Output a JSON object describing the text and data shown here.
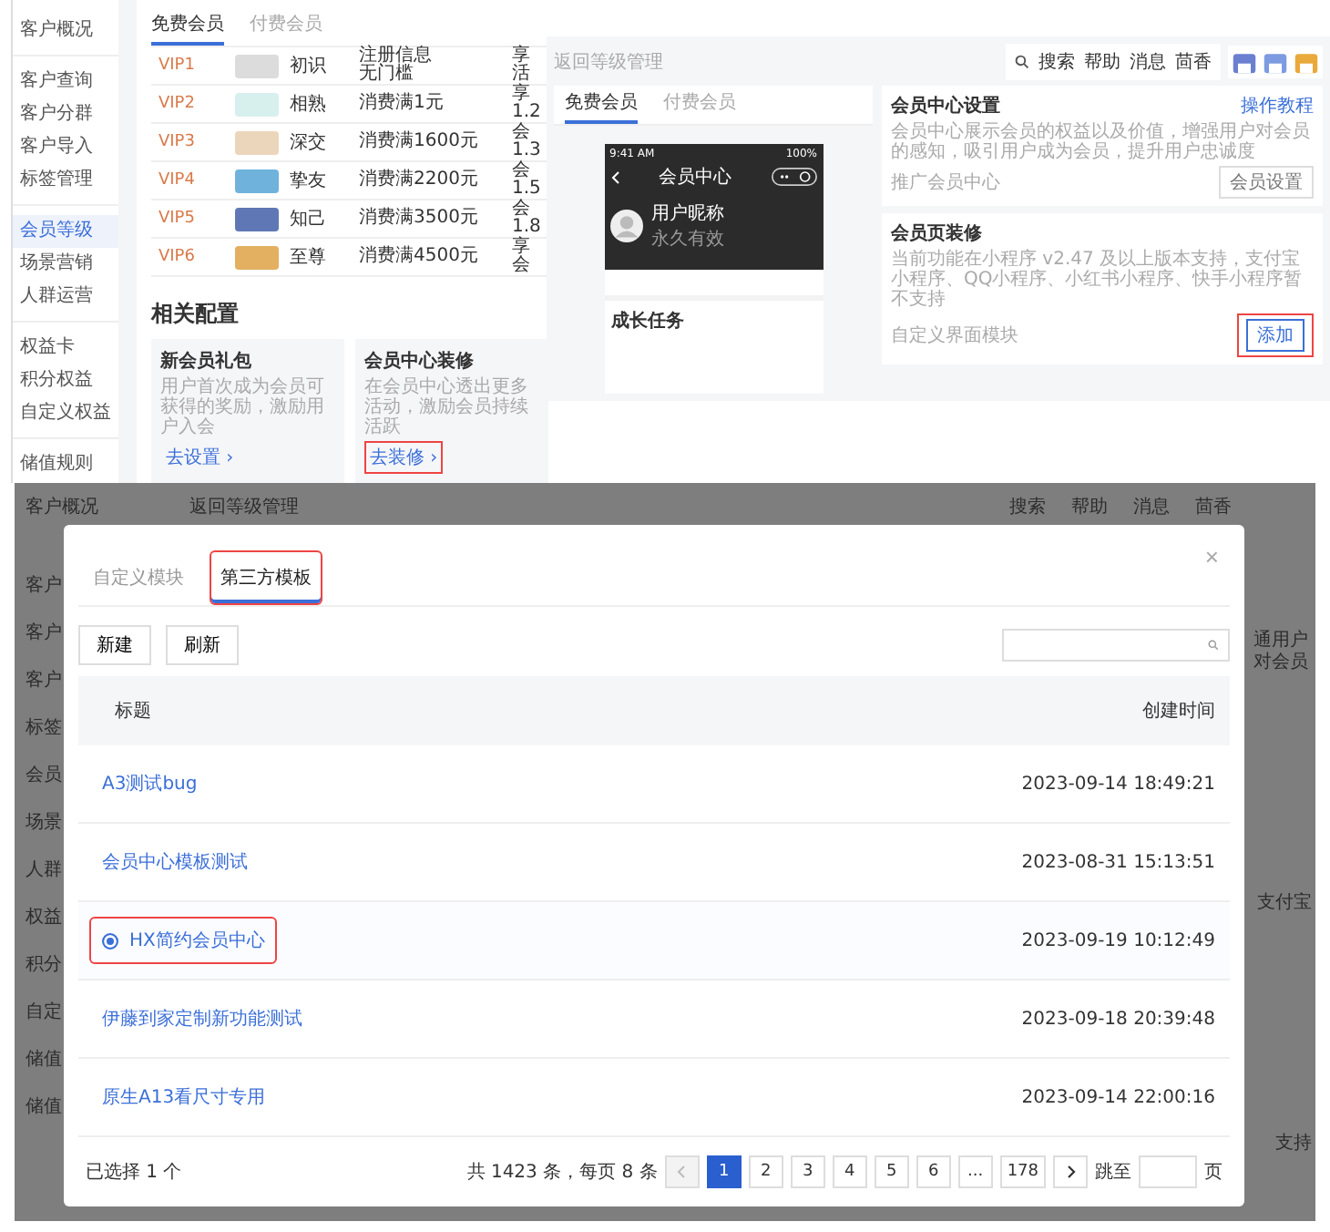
{
  "top_left": {
    "sidebar": [
      {
        "label": "客户概况",
        "selected": false,
        "group_end": true
      },
      {
        "label": "客户查询",
        "selected": false,
        "group_end": false
      },
      {
        "label": "客户分群",
        "selected": false,
        "group_end": false
      },
      {
        "label": "客户导入",
        "selected": false,
        "group_end": false
      },
      {
        "label": "标签管理",
        "selected": false,
        "group_end": true
      },
      {
        "label": "会员等级",
        "selected": true,
        "group_end": false
      },
      {
        "label": "场景营销",
        "selected": false,
        "group_end": false
      },
      {
        "label": "人群运营",
        "selected": false,
        "group_end": true
      },
      {
        "label": "权益卡",
        "selected": false,
        "group_end": false
      },
      {
        "label": "积分权益",
        "selected": false,
        "group_end": false
      },
      {
        "label": "自定义权益",
        "selected": false,
        "group_end": true
      },
      {
        "label": "储值规则",
        "selected": false,
        "group_end": false
      }
    ],
    "tabs": [
      {
        "label": "免费会员",
        "selected": true
      },
      {
        "label": "付费会员",
        "selected": false
      }
    ],
    "levels": [
      {
        "level": "VIP1",
        "color": "#dcdcdc",
        "name": "初识",
        "condition": [
          "注册信息",
          "无门槛"
        ],
        "column_5": [
          "享",
          "活"
        ]
      },
      {
        "level": "VIP2",
        "color": "#d7f0ee",
        "name": "相熟",
        "condition": [
          "消费满1元"
        ],
        "column_5": [
          "享",
          "1.2"
        ]
      },
      {
        "level": "VIP3",
        "color": "#ecd6bb",
        "name": "深交",
        "condition": [
          "消费满1600元"
        ],
        "column_5": [
          "会",
          "1.3"
        ]
      },
      {
        "level": "VIP4",
        "color": "#6fb3dc",
        "name": "挚友",
        "condition": [
          "消费满2200元"
        ],
        "column_5": [
          "会",
          "1.5"
        ]
      },
      {
        "level": "VIP5",
        "color": "#5f78b5",
        "name": "知己",
        "condition": [
          "消费满3500元"
        ],
        "column_5": [
          "会",
          "1.8"
        ]
      },
      {
        "level": "VIP6",
        "color": "#e2b060",
        "name": "至尊",
        "condition": [
          "消费满4500元"
        ],
        "column_5": [
          "享",
          "会"
        ]
      }
    ],
    "related": {
      "title": "相关配置",
      "cards": [
        {
          "title": "新会员礼包",
          "desc": "用户首次成为会员可获得的奖励，激励用户入会",
          "link": "去设置 ›",
          "highlighted": false
        },
        {
          "title": "会员中心装修",
          "desc": "在会员中心透出更多活动，激励会员持续活跃",
          "link": "去装修 ›",
          "highlighted": true
        }
      ]
    }
  },
  "top_right": {
    "back": "返回等级管理",
    "header": [
      "搜索",
      "帮助",
      "消息",
      "茴香"
    ],
    "tabs": [
      {
        "label": "免费会员",
        "selected": true
      },
      {
        "label": "付费会员",
        "selected": false
      }
    ],
    "phone": {
      "time": "9:41 AM",
      "battery": "100%",
      "title": "会员中心",
      "nickname": "用户昵称",
      "validity": "永久有效",
      "section": "成长任务"
    },
    "settings": {
      "title": "会员中心设置",
      "link": "操作教程",
      "desc": "会员中心展示会员的权益以及价值，增强用户对会员的感知，吸引用户成为会员，提升用户忠诚度",
      "label": "推广会员中心",
      "button": "会员设置"
    },
    "decor": {
      "title": "会员页装修",
      "desc": "当前功能在小程序 v2.47 及以上版本支持，支付宝小程序、QQ小程序、小红书小程序、快手小程序暂不支持",
      "label": "自定义界面模块",
      "button": "添加",
      "highlighted": true
    }
  },
  "background": {
    "title": "客户概况",
    "back": "返回等级管理",
    "header": [
      "搜索",
      "帮助",
      "消息",
      "茴香"
    ],
    "sidebar": [
      "客户",
      "客户",
      "客户",
      "标签",
      "会员",
      "场景",
      "人群",
      "权益",
      "积分",
      "自定",
      "储值",
      "储值"
    ],
    "right_texts": [
      "通用户对会员",
      "支付宝",
      "支持"
    ]
  },
  "modal": {
    "tabs": [
      {
        "label": "自定义模块",
        "selected": false,
        "highlighted": false
      },
      {
        "label": "第三方模板",
        "selected": true,
        "highlighted": true
      }
    ],
    "close": "×",
    "buttons": [
      "新建",
      "刷新"
    ],
    "columns": [
      "标题",
      "创建时间"
    ],
    "rows": [
      {
        "title": "A3测试bug",
        "created": "2023-09-14 18:49:21",
        "selected": false
      },
      {
        "title": "会员中心模板测试",
        "created": "2023-08-31 15:13:51",
        "selected": false
      },
      {
        "title": "HX简约会员中心",
        "created": "2023-09-19 10:12:49",
        "selected": true
      },
      {
        "title": "伊藤到家定制新功能测试",
        "created": "2023-09-18 20:39:48",
        "selected": false
      },
      {
        "title": "原生A13看尺寸专用",
        "created": "2023-09-14 22:00:16",
        "selected": false
      }
    ],
    "selected_count": "已选择 1 个",
    "total": "共 1423 条，每页 8 条",
    "pages": [
      {
        "label": "1",
        "selected": true
      },
      {
        "label": "2",
        "selected": false
      },
      {
        "label": "3",
        "selected": false
      },
      {
        "label": "4",
        "selected": false
      },
      {
        "label": "5",
        "selected": false
      },
      {
        "label": "6",
        "selected": false
      },
      {
        "label": "...",
        "selected": false
      },
      {
        "label": "178",
        "selected": false
      }
    ],
    "jump_label": "跳至",
    "page_unit": "页"
  }
}
